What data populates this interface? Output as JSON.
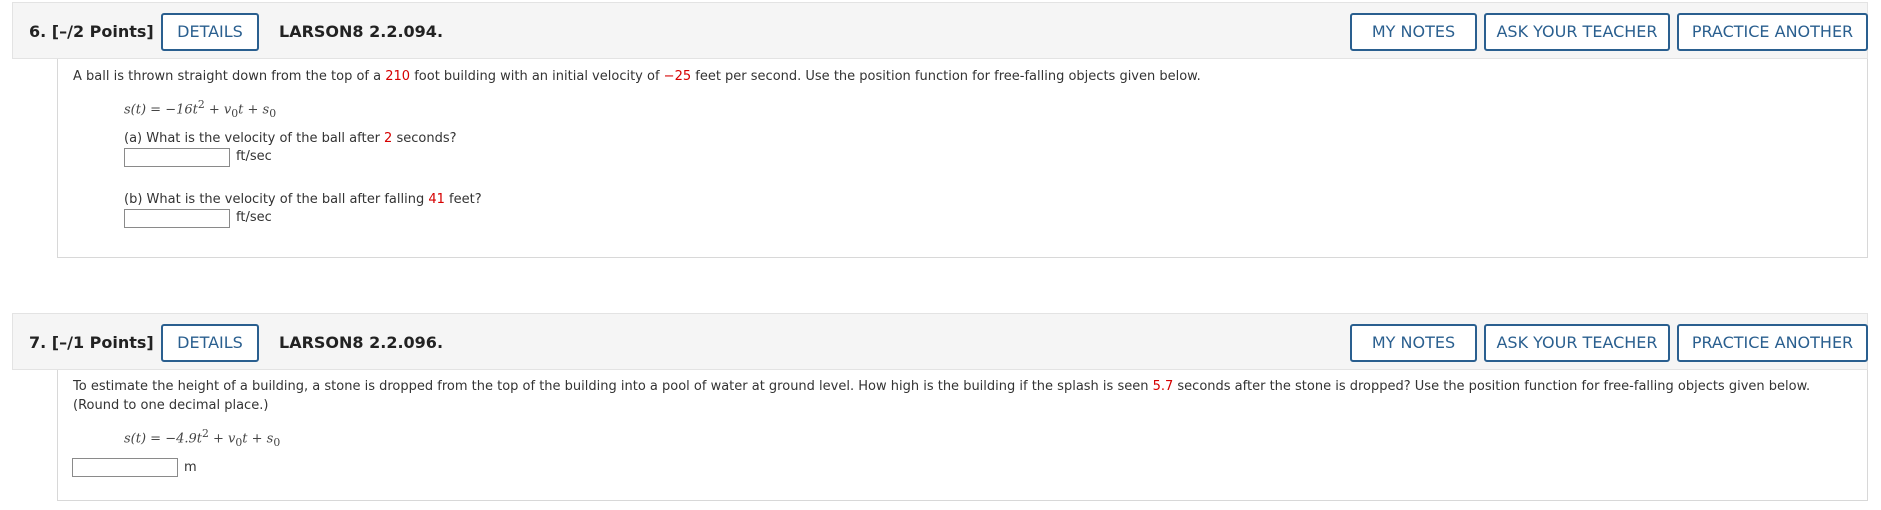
{
  "buttons": {
    "details": "DETAILS",
    "my_notes": "MY NOTES",
    "ask_teacher": "ASK YOUR TEACHER",
    "practice_another": "PRACTICE ANOTHER"
  },
  "q6": {
    "label": "6. [–/2 Points]",
    "code": "LARSON8 2.2.094.",
    "text_pre": "A ball is thrown straight down from the top of a ",
    "height": "210",
    "text_mid": " foot building with an initial velocity of ",
    "velocity": "−25",
    "text_post": " feet per second. Use the position function for free-falling objects given below.",
    "formula": {
      "lhs": "s(t) = −16t",
      "exp": "2",
      "rest1": " + v",
      "sub1": "0",
      "rest2": "t + s",
      "sub2": "0"
    },
    "part_a": {
      "pre": "(a) What is the velocity of the ball after ",
      "value": "2",
      "post": " seconds?",
      "input_value": "",
      "unit": "ft/sec"
    },
    "part_b": {
      "pre": "(b) What is the velocity of the ball after falling ",
      "value": "41",
      "post": " feet?",
      "input_value": "",
      "unit": "ft/sec"
    }
  },
  "q7": {
    "label": "7. [–/1 Points]",
    "code": "LARSON8 2.2.096.",
    "text_pre": "To estimate the height of a building, a stone is dropped from the top of the building into a pool of water at ground level. How high is the building if the splash is seen ",
    "time": "5.7",
    "text_post": " seconds after the stone is dropped? Use the position function for free-falling objects given below.",
    "text_line2": "(Round to one decimal place.)",
    "formula": {
      "lhs": "s(t) = −4.9t",
      "exp": "2",
      "rest1": " + v",
      "sub1": "0",
      "rest2": "t + s",
      "sub2": "0"
    },
    "input_value": "",
    "unit": "m"
  }
}
